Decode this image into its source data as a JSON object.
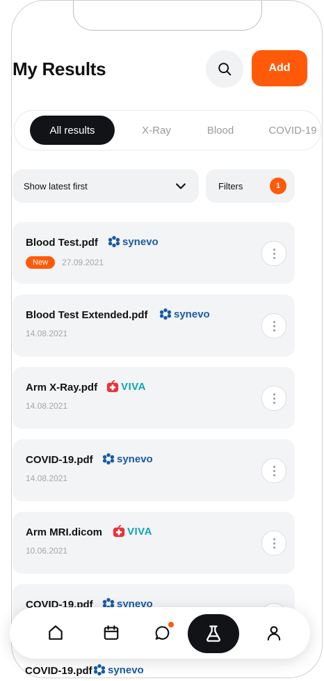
{
  "header": {
    "title": "My Results",
    "add_label": "Add"
  },
  "tabs": [
    {
      "label": "All results",
      "active": true
    },
    {
      "label": "X-Ray",
      "active": false
    },
    {
      "label": "Blood",
      "active": false
    },
    {
      "label": "COVID-19",
      "active": false
    }
  ],
  "sort": {
    "label": "Show latest first"
  },
  "filters": {
    "label": "Filters",
    "count": "1"
  },
  "results": [
    {
      "name": "Blood Test.pdf",
      "provider": "synevo",
      "date": "27.09.2021",
      "badge": "New"
    },
    {
      "name": "Blood Test Extended.pdf",
      "provider": "synevo",
      "date": "14.08.2021"
    },
    {
      "name": "Arm X-Ray.pdf",
      "provider": "VIVA",
      "date": "14.08.2021"
    },
    {
      "name": "COVID-19.pdf",
      "provider": "synevo",
      "date": "14.08.2021"
    },
    {
      "name": "Arm MRI.dicom",
      "provider": "VIVA",
      "date": "10.06.2021"
    },
    {
      "name": "COVID-19.pdf",
      "provider": "synevo",
      "date": ""
    }
  ],
  "peek": {
    "name": "COVID-19.pdf",
    "provider": "synevo"
  },
  "colors": {
    "accent": "#ff5a0a",
    "dark": "#111317",
    "card": "#f3f4f5",
    "synevo": "#1a5aa6",
    "viva": "#0aa7b8",
    "viva_icon": "#e8343a"
  },
  "icons": {
    "nav": [
      "home-icon",
      "calendar-icon",
      "chat-icon",
      "lab-flask-icon",
      "profile-icon"
    ],
    "search": "search-icon"
  }
}
